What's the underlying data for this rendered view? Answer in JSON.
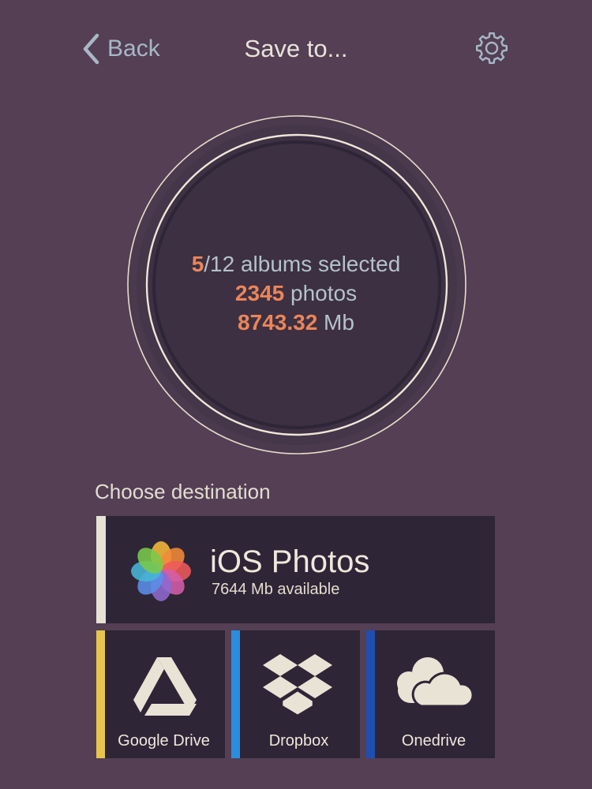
{
  "nav": {
    "back_label": "Back",
    "title": "Save to..."
  },
  "summary": {
    "albums_selected": "5",
    "albums_total_text": "/12 albums selected",
    "photos_count": "2345",
    "photos_text": " photos",
    "size_value": "8743.32",
    "size_unit": " Mb"
  },
  "destinations": {
    "section_label": "Choose destination",
    "primary": {
      "name": "iOS Photos",
      "available": "7644 Mb available",
      "icon": "photos-flower-icon",
      "accent_color": "#e7e2d4"
    },
    "services": [
      {
        "name": "Google Drive",
        "icon": "google-drive-icon",
        "accent_color": "#e5c64a"
      },
      {
        "name": "Dropbox",
        "icon": "dropbox-icon",
        "accent_color": "#2a8ee0"
      },
      {
        "name": "Onedrive",
        "icon": "cloud-icon",
        "accent_color": "#1e4fb0"
      }
    ]
  },
  "colors": {
    "background": "#543f55",
    "tile_background": "#2e2536",
    "highlight": "#ec8558",
    "secondary_text": "#b4c2cc"
  }
}
